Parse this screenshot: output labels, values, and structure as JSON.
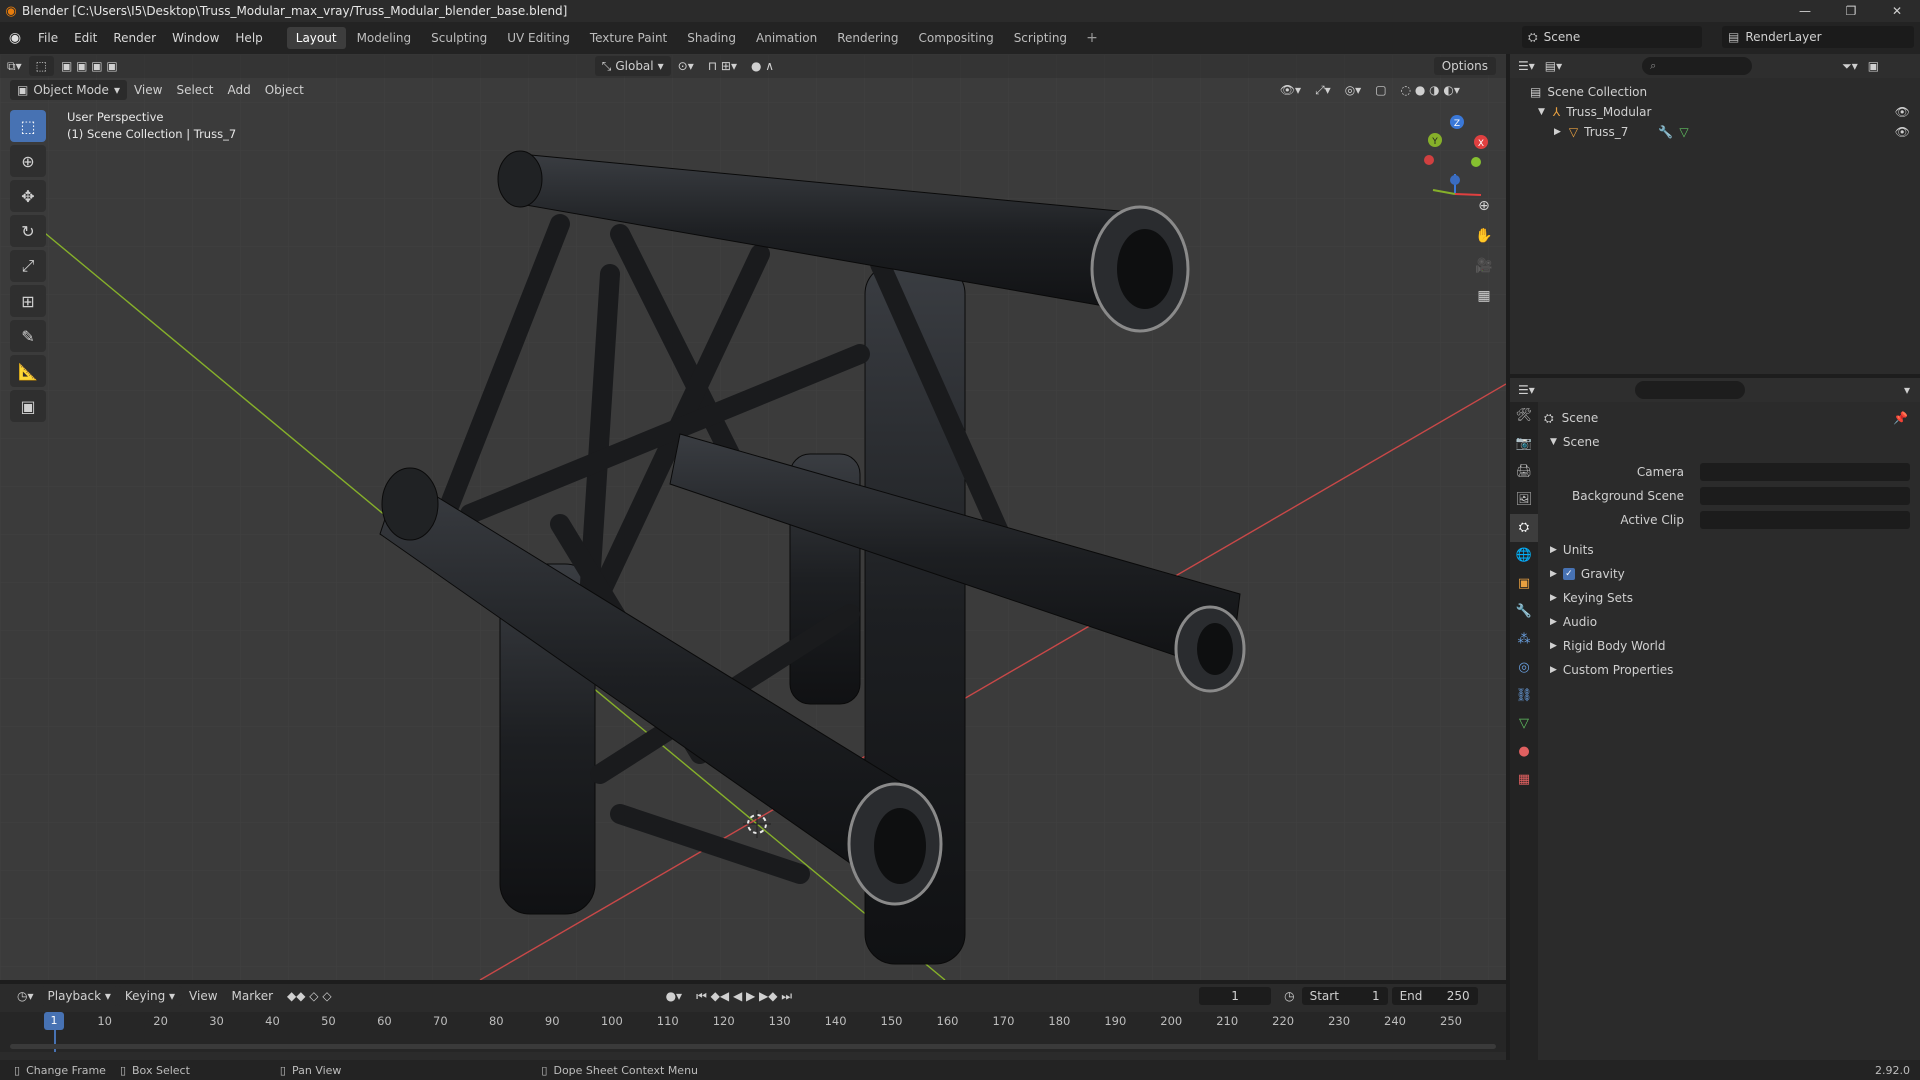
{
  "window": {
    "title": "Blender [C:\\Users\\I5\\Desktop\\Truss_Modular_max_vray/Truss_Modular_blender_base.blend]",
    "minimize": "—",
    "maximize": "❐",
    "close": "✕"
  },
  "menu": {
    "items": [
      "File",
      "Edit",
      "Render",
      "Window",
      "Help"
    ],
    "workspaces": [
      "Layout",
      "Modeling",
      "Sculpting",
      "UV Editing",
      "Texture Paint",
      "Shading",
      "Animation",
      "Rendering",
      "Compositing",
      "Scripting"
    ],
    "active_workspace": "Layout",
    "scene": "Scene",
    "render_layer": "RenderLayer"
  },
  "viewport": {
    "mode": "Object Mode",
    "header_menus": [
      "View",
      "Select",
      "Add",
      "Object"
    ],
    "transform_orientation": "Global",
    "options_label": "Options",
    "info_line1": "User Perspective",
    "info_line2": "(1) Scene Collection | Truss_7",
    "gizmo": {
      "x": "X",
      "y": "Y",
      "z": "Z"
    }
  },
  "outliner": {
    "root": "Scene Collection",
    "collection": "Truss_Modular",
    "object": "Truss_7"
  },
  "properties": {
    "header": "Scene",
    "panel": "Scene",
    "fields": [
      {
        "label": "Camera"
      },
      {
        "label": "Background Scene"
      },
      {
        "label": "Active Clip"
      }
    ],
    "sections": [
      "Units",
      "Gravity",
      "Keying Sets",
      "Audio",
      "Rigid Body World",
      "Custom Properties"
    ]
  },
  "timeline": {
    "menus": [
      "Playback",
      "Keying",
      "View",
      "Marker"
    ],
    "current_frame": "1",
    "start_label": "Start",
    "start_value": "1",
    "end_label": "End",
    "end_value": "250",
    "ticks": [
      "1",
      "10",
      "20",
      "30",
      "40",
      "50",
      "60",
      "70",
      "80",
      "90",
      "100",
      "110",
      "120",
      "130",
      "140",
      "150",
      "160",
      "170",
      "180",
      "190",
      "200",
      "210",
      "220",
      "230",
      "240",
      "250"
    ]
  },
  "statusbar": {
    "change_frame": "Change Frame",
    "box_select": "Box Select",
    "pan_view": "Pan View",
    "context_menu": "Dope Sheet Context Menu",
    "version": "2.92.0"
  },
  "colors": {
    "accent": "#4772b3",
    "x_axis": "#e04040",
    "y_axis": "#86b02a",
    "z_axis": "#3a78d8",
    "blender_orange": "#e87d0d"
  }
}
